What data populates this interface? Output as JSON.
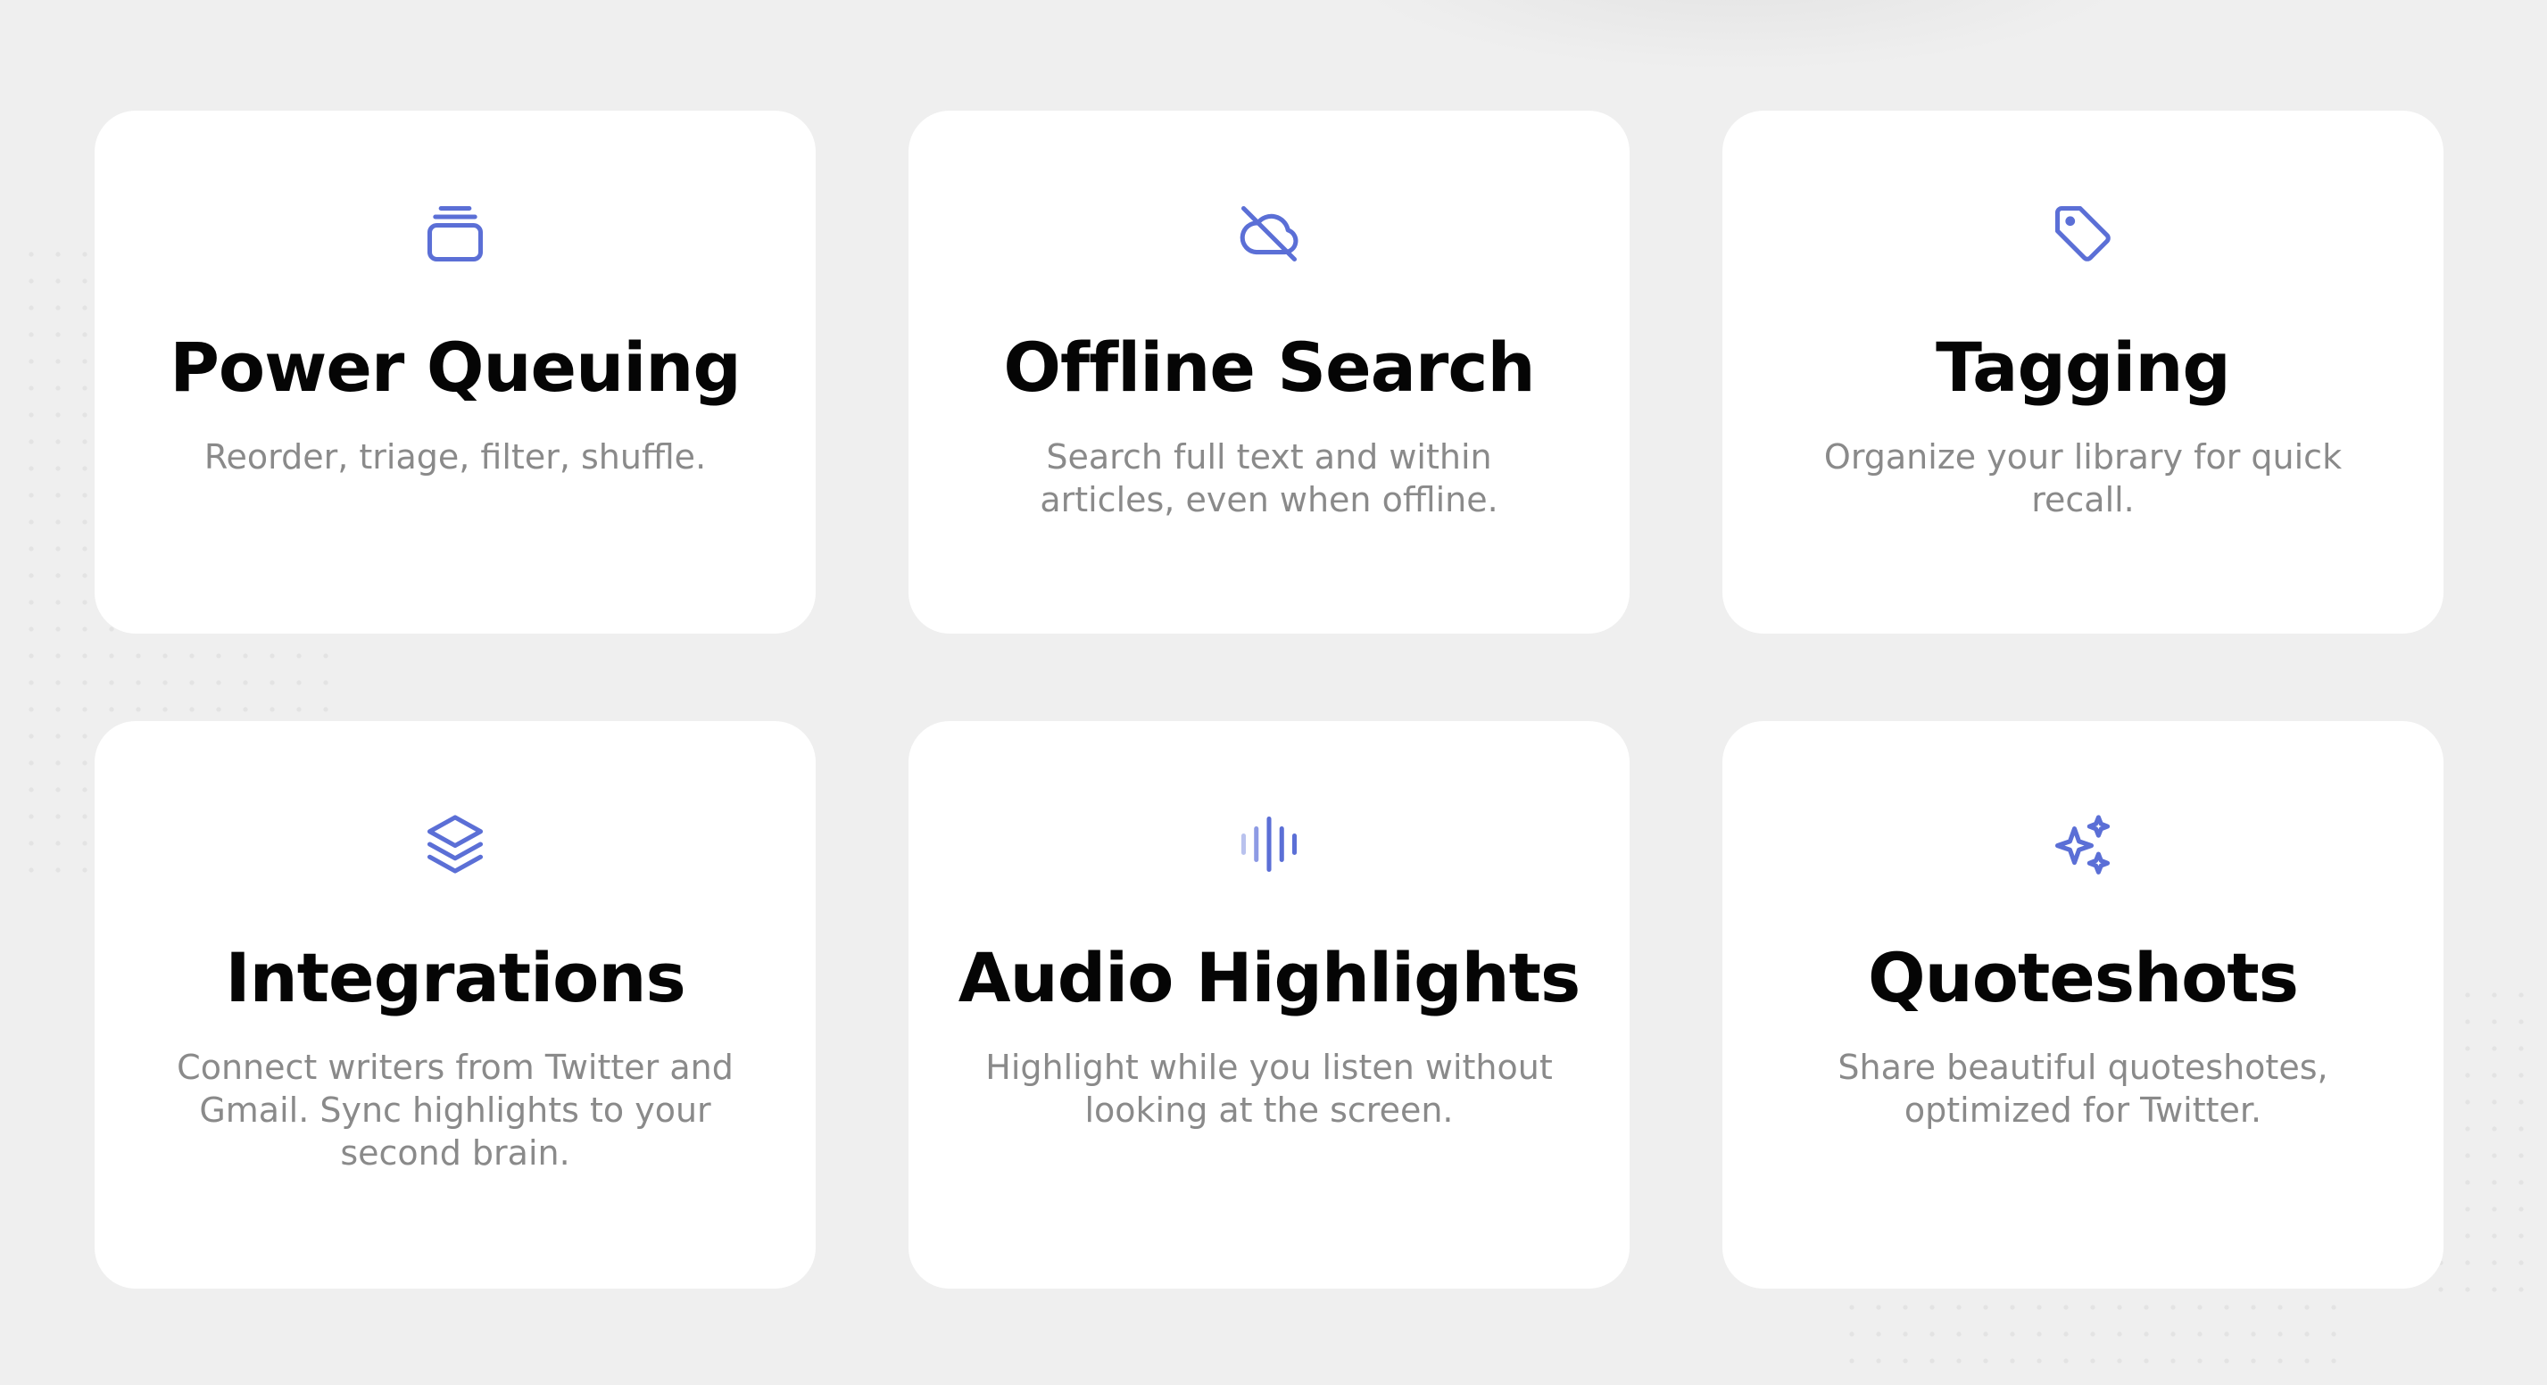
{
  "accent_color": "#5b6fd6",
  "features": [
    {
      "icon": "stack-icon",
      "title": "Power Queuing",
      "description": "Reorder, triage, filter, shuffle."
    },
    {
      "icon": "cloud-off-icon",
      "title": "Offline Search",
      "description": "Search full text and within articles, even when offline."
    },
    {
      "icon": "tag-icon",
      "title": "Tagging",
      "description": "Organize your library for quick recall."
    },
    {
      "icon": "layers-icon",
      "title": "Integrations",
      "description": "Connect writers from Twitter and Gmail. Sync highlights to your second brain."
    },
    {
      "icon": "audio-waveform-icon",
      "title": "Audio Highlights",
      "description": "Highlight while you listen without looking at the screen."
    },
    {
      "icon": "sparkles-icon",
      "title": "Quoteshots",
      "description": "Share beautiful quoteshotes, optimized for Twitter."
    }
  ]
}
